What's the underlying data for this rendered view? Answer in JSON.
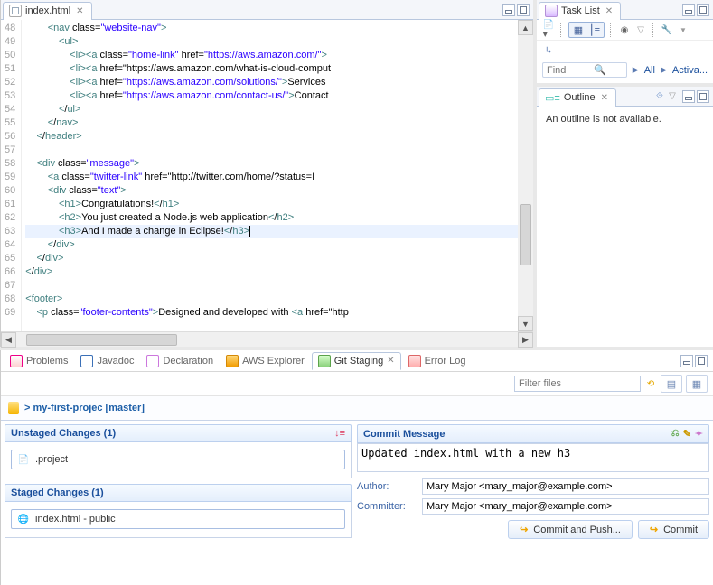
{
  "editor": {
    "tab_title": "index.html",
    "lines": [
      {
        "n": 48,
        "t": "        <nav class=\"website-nav\">"
      },
      {
        "n": 49,
        "t": "            <ul>"
      },
      {
        "n": 50,
        "t": "                <li><a class=\"home-link\" href=\"https://aws.amazon.com/\">"
      },
      {
        "n": 51,
        "t": "                <li><a href=\"https://aws.amazon.com/what-is-cloud-comput"
      },
      {
        "n": 52,
        "t": "                <li><a href=\"https://aws.amazon.com/solutions/\">Services"
      },
      {
        "n": 53,
        "t": "                <li><a href=\"https://aws.amazon.com/contact-us/\">Contact"
      },
      {
        "n": 54,
        "t": "            </ul>"
      },
      {
        "n": 55,
        "t": "        </nav>"
      },
      {
        "n": 56,
        "t": "    </header>"
      },
      {
        "n": 57,
        "t": ""
      },
      {
        "n": 58,
        "t": "    <div class=\"message\">"
      },
      {
        "n": 59,
        "t": "        <a class=\"twitter-link\" href=\"http://twitter.com/home/?status=I"
      },
      {
        "n": 60,
        "t": "        <div class=\"text\">"
      },
      {
        "n": 61,
        "t": "            <h1>Congratulations!</h1>"
      },
      {
        "n": 62,
        "t": "            <h2>You just created a Node.js web application</h2>"
      },
      {
        "n": 63,
        "t": "            <h3>And I made a change in Eclipse!</h3>",
        "hl": true
      },
      {
        "n": 64,
        "t": "        </div>"
      },
      {
        "n": 65,
        "t": "    </div>"
      },
      {
        "n": 66,
        "t": "</div>"
      },
      {
        "n": 67,
        "t": ""
      },
      {
        "n": 68,
        "t": "<footer>"
      },
      {
        "n": 69,
        "t": "    <p class=\"footer-contents\">Designed and developed with <a href=\"http"
      }
    ]
  },
  "task_list": {
    "title": "Task List",
    "find_placeholder": "Find",
    "all_label": "All",
    "activate_label": "Activa..."
  },
  "outline": {
    "title": "Outline",
    "body": "An outline is not available."
  },
  "bottom_tabs": {
    "problems": "Problems",
    "javadoc": "Javadoc",
    "declaration": "Declaration",
    "aws": "AWS Explorer",
    "git": "Git Staging",
    "error": "Error Log"
  },
  "filter_placeholder": "Filter files",
  "repo": {
    "label": "> my-first-projec [master]"
  },
  "unstaged": {
    "title": "Unstaged Changes (1)",
    "items": [
      ".project"
    ]
  },
  "staged": {
    "title": "Staged Changes (1)",
    "items": [
      "index.html - public"
    ]
  },
  "commit": {
    "title": "Commit Message",
    "message": "Updated index.html with a new h3",
    "author_label": "Author:",
    "committer_label": "Committer:",
    "author": "Mary Major <mary_major@example.com>",
    "committer": "Mary Major <mary_major@example.com>",
    "commit_push": "Commit and Push...",
    "commit": "Commit"
  }
}
